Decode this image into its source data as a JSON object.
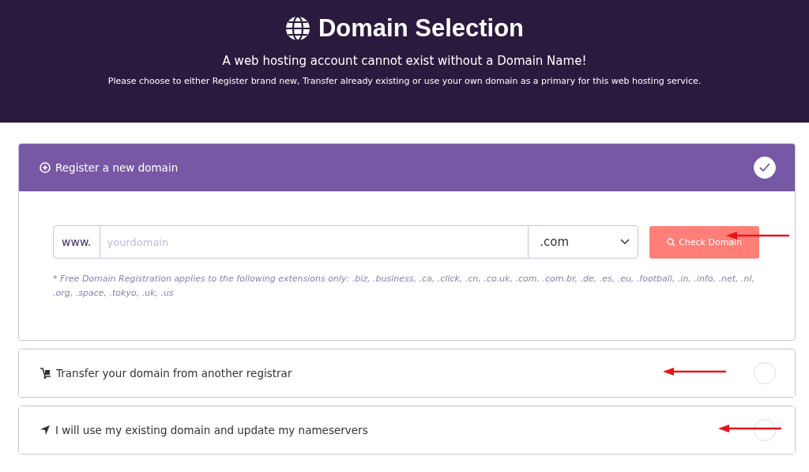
{
  "header": {
    "title": "Domain Selection",
    "subtitle": "A web hosting account cannot exist without a Domain Name!",
    "description": "Please choose to either Register brand new, Transfer already existing or use your own domain as a primary for this web hosting service."
  },
  "options": [
    {
      "kind": "register",
      "label": "Register a new domain",
      "selected": true,
      "prefix": "www.",
      "placeholder": "yourdomain",
      "extension": ".com",
      "button": "Check Domain",
      "note": "* Free Domain Registration applies to the following extensions only: .biz, .business, .ca, .click, .cn, .co.uk, .com, .com.br, .de, .es, .eu, .football, .in, .info, .net, .nl, .org, .space, .tokyo, .uk, .us"
    },
    {
      "kind": "transfer",
      "label": "Transfer your domain from another registrar",
      "selected": false
    },
    {
      "kind": "existing",
      "label": "I will use my existing domain and update my nameservers",
      "selected": false
    }
  ]
}
